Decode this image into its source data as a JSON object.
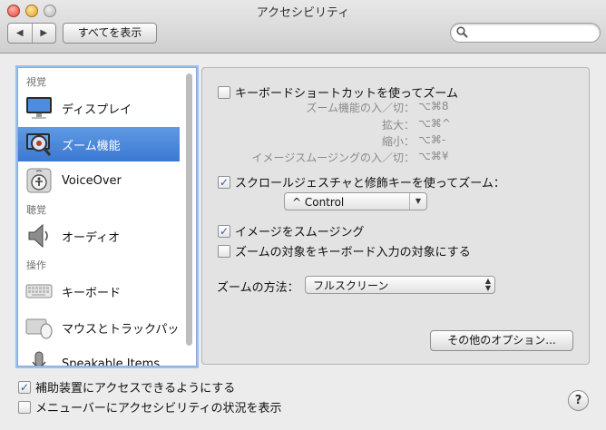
{
  "window": {
    "title": "アクセシビリティ"
  },
  "toolbar": {
    "back": "◀",
    "forward": "▶",
    "show_all": "すべてを表示",
    "search_placeholder": ""
  },
  "sidebar": {
    "sections": [
      "視覚",
      "聴覚",
      "操作"
    ],
    "items": [
      {
        "label": "ディスプレイ",
        "icon": "display-icon"
      },
      {
        "label": "ズーム機能",
        "icon": "zoom-icon"
      },
      {
        "label": "VoiceOver",
        "icon": "voiceover-icon"
      },
      {
        "label": "オーディオ",
        "icon": "speaker-icon"
      },
      {
        "label": "キーボード",
        "icon": "keyboard-icon"
      },
      {
        "label": "マウスとトラックパッ",
        "icon": "mouse-icon"
      },
      {
        "label": "Speakable Items",
        "icon": "microphone-icon"
      }
    ],
    "selected": "ズーム機能"
  },
  "zoom": {
    "keyboard_shortcuts": {
      "label": "キーボードショートカットを使ってズーム",
      "checked": false,
      "shortcuts": [
        {
          "name": "ズーム機能の入／切：",
          "keys": "⌥⌘8"
        },
        {
          "name": "拡大：",
          "keys": "⌥⌘^"
        },
        {
          "name": "縮小：",
          "keys": "⌥⌘-"
        },
        {
          "name": "イメージスムージングの入／切：",
          "keys": "⌥⌘¥"
        }
      ]
    },
    "scroll_gesture": {
      "label": "スクロールジェスチャと修飾キーを使ってズーム：",
      "checked": true,
      "modifier": "^ Control"
    },
    "smooth_images": {
      "label": "イメージをスムージング",
      "checked": true
    },
    "follow_focus": {
      "label": "ズームの対象をキーボード入力の対象にする",
      "checked": false
    },
    "zoom_style": {
      "label": "ズームの方法：",
      "value": "フルスクリーン"
    },
    "more_options": "その他のオプション..."
  },
  "footer": {
    "assistive": {
      "label": "補助装置にアクセスできるようにする",
      "checked": true
    },
    "menubar": {
      "label": "メニューバーにアクセシビリティの状況を表示",
      "checked": false
    },
    "help": "?"
  },
  "colors": {
    "selection": "#3b78d2",
    "focus_ring": "#9cc0ef",
    "checkmark": "#2f5ca6"
  }
}
